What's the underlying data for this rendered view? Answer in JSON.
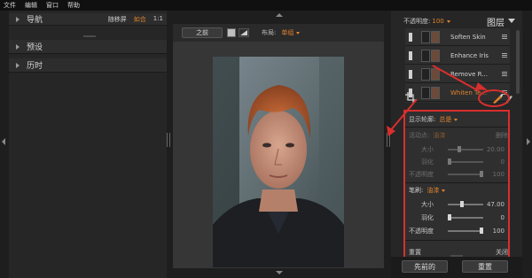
{
  "menubar": {
    "items": [
      "文件",
      "编辑",
      "窗口",
      "帮助"
    ]
  },
  "left_panel": {
    "navigator_title": "导航",
    "navigator_options": [
      "随移屏",
      "如合",
      "1:1"
    ],
    "presets_title": "预设",
    "history_title": "历时"
  },
  "toolbar": {
    "before_label": "之前",
    "layout_label": "布局:",
    "layout_value": "单组"
  },
  "layers_panel": {
    "opacity_label": "不透明度:",
    "opacity_value": "100",
    "title": "图层",
    "layers": [
      {
        "name": "Soften Skin",
        "active": false
      },
      {
        "name": "Enhance Iris",
        "active": false
      },
      {
        "name": "Remove R...",
        "active": false
      },
      {
        "name": "Whiten Te...",
        "active": true
      }
    ]
  },
  "properties": {
    "display_mask_label": "显示轮廓:",
    "display_mask_value": "总是",
    "mode_label": "活动点:",
    "mode_value": "油漆",
    "delete_label": "删除",
    "brush_label": "笔刷:",
    "brush_value": "油漆",
    "upper": [
      {
        "label": "大小",
        "value": "20.00",
        "pos": 0.3
      },
      {
        "label": "羽化",
        "value": "0",
        "pos": 0.0
      },
      {
        "label": "不透明度",
        "value": "100",
        "pos": 1.0
      }
    ],
    "lower": [
      {
        "label": "大小",
        "value": "47.00",
        "pos": 0.4
      },
      {
        "label": "羽化",
        "value": "0",
        "pos": 0.0
      },
      {
        "label": "不透明度",
        "value": "100",
        "pos": 1.0
      }
    ],
    "reset_label": "重置",
    "close_label": "关闭"
  },
  "footer": {
    "previous_label": "先前的",
    "reset_label": "重置"
  },
  "colors": {
    "accent": "#e0832f",
    "annotation": "#d92e2e"
  }
}
